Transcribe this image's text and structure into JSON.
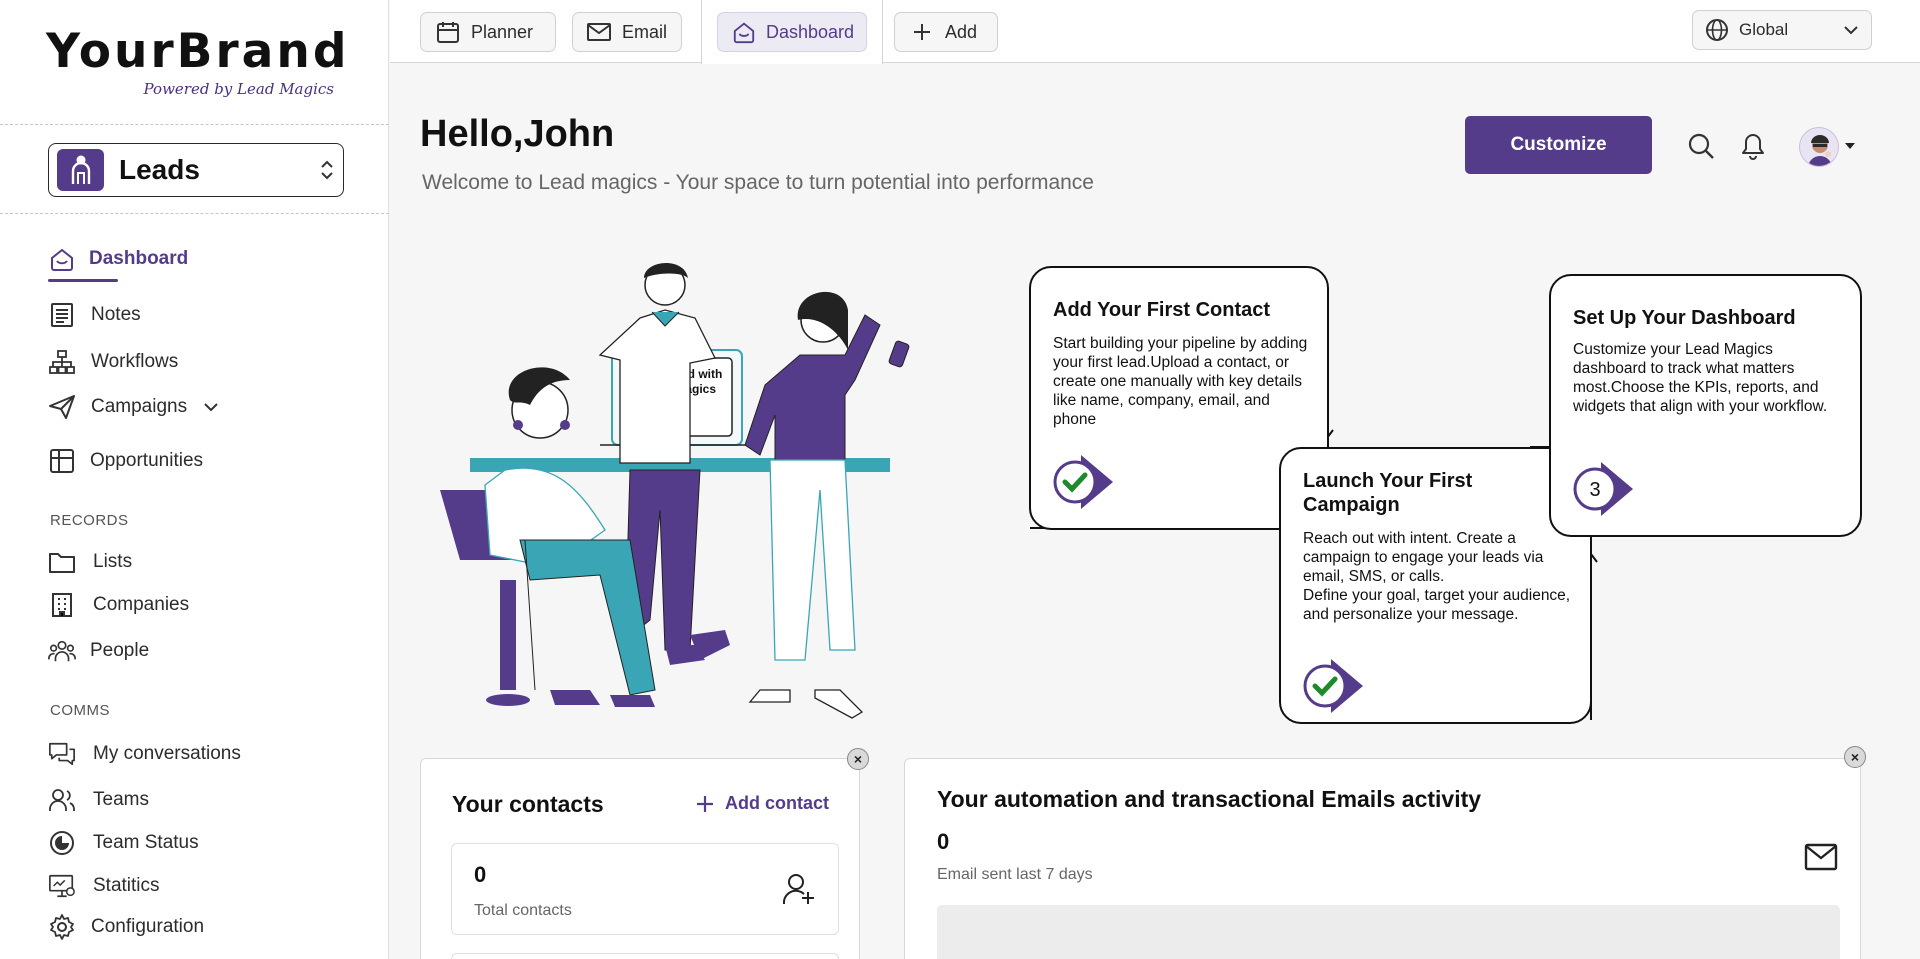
{
  "brand": {
    "name": "YourBrand",
    "tagline": "Powered by Lead Magics"
  },
  "module_selector": {
    "label": "Leads"
  },
  "nav": {
    "dashboard": "Dashboard",
    "notes": "Notes",
    "workflows": "Workflows",
    "campaigns": "Campaigns",
    "opportunities": "Opportunities"
  },
  "records": {
    "heading": "RECORDS",
    "lists": "Lists",
    "companies": "Companies",
    "people": "People"
  },
  "comms": {
    "heading": "COMMS",
    "conversations": "My conversations",
    "teams": "Teams",
    "team_status": "Team Status",
    "statistics": "Statitics",
    "configuration": "Configuration"
  },
  "tabs": {
    "planner": "Planner",
    "email": "Email",
    "dashboard": "Dashboard",
    "add": "Add"
  },
  "scope": {
    "selected": "Global"
  },
  "header": {
    "greeting": "Hello,John",
    "welcome": "Welcome to Lead magics - Your space to turn potential into performance",
    "customize": "Customize"
  },
  "illustration": {
    "screen_text_1": "Get started with",
    "screen_text_2": "Lead Magics"
  },
  "steps": [
    {
      "title": "Add Your First Contact",
      "body": "Start building your pipeline by adding your first lead.Upload a contact, or create one manually with key details like name, company, email, and phone",
      "status": "done"
    },
    {
      "title": "Launch Your First Campaign",
      "body": "Reach out with intent. Create a campaign to engage your leads via email, SMS, or calls.\n Define your goal, target your audience, and personalize your message.",
      "status": "done"
    },
    {
      "title": "Set Up Your Dashboard",
      "body": "Customize your Lead Magics dashboard to track what matters most.Choose the KPIs, reports, and widgets that align with your workflow.",
      "number": "3"
    }
  ],
  "contacts_card": {
    "title": "Your contacts",
    "add_label": "Add contact",
    "total_value": "0",
    "total_label": "Total contacts"
  },
  "email_card": {
    "title": "Your automation and transactional Emails activity",
    "sent_value": "0",
    "sent_label": "Email sent last 7 days"
  },
  "colors": {
    "accent": "#553c8b",
    "teal": "#3aa6b5",
    "check": "#1e8a2c"
  },
  "close_glyph": "×"
}
